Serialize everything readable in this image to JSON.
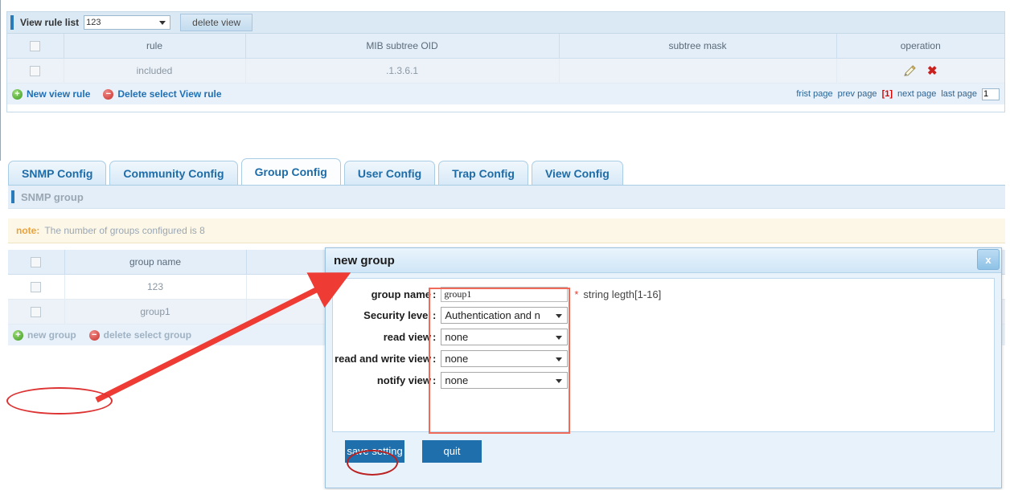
{
  "view_panel": {
    "toolbar": {
      "label": "View rule list",
      "select_value": "123",
      "delete_button": "delete view"
    },
    "columns": [
      "",
      "rule",
      "MIB subtree OID",
      "subtree mask",
      "operation"
    ],
    "rows": [
      {
        "rule": "included",
        "oid": ".1.3.6.1",
        "mask": ""
      }
    ],
    "actions": {
      "new": "New view rule",
      "delete": "Delete select View rule"
    },
    "pager": {
      "first": "frist page",
      "prev": "prev page",
      "current": "[1]",
      "next": "next page",
      "last": "last page",
      "jump_value": "1"
    }
  },
  "tabs": [
    {
      "label": "SNMP Config",
      "active": false
    },
    {
      "label": "Community Config",
      "active": false
    },
    {
      "label": "Group Config",
      "active": true
    },
    {
      "label": "User Config",
      "active": false
    },
    {
      "label": "Trap Config",
      "active": false
    },
    {
      "label": "View Config",
      "active": false
    }
  ],
  "group_panel": {
    "section_title": "SNMP group",
    "note_key": "note:",
    "note_text": "The number of groups configured is 8",
    "columns": [
      "",
      "group name"
    ],
    "rows": [
      {
        "name": "123"
      },
      {
        "name": "group1"
      }
    ],
    "actions": {
      "new": "new group",
      "delete": "delete select group"
    }
  },
  "modal": {
    "title": "new group",
    "close_label": "x",
    "fields": {
      "group_name": {
        "label": "group name",
        "value": "group1",
        "required_mark": "*",
        "hint": "string legth[1-16]"
      },
      "security_level": {
        "label": "Security level",
        "value": "Authentication and n"
      },
      "read_view": {
        "label": "read view",
        "value": "none"
      },
      "read_write_view": {
        "label": "read and write view",
        "value": "none"
      },
      "notify_view": {
        "label": "notify view",
        "value": "none"
      }
    },
    "buttons": {
      "save": "save setting",
      "quit": "quit"
    }
  },
  "colors": {
    "accent": "#2b7bba",
    "tab_text": "#1d6ca8",
    "note_key": "#e8a33d",
    "annotation": "#dd3333",
    "primary_button": "#1f6fad",
    "required": "#e23b2e"
  }
}
